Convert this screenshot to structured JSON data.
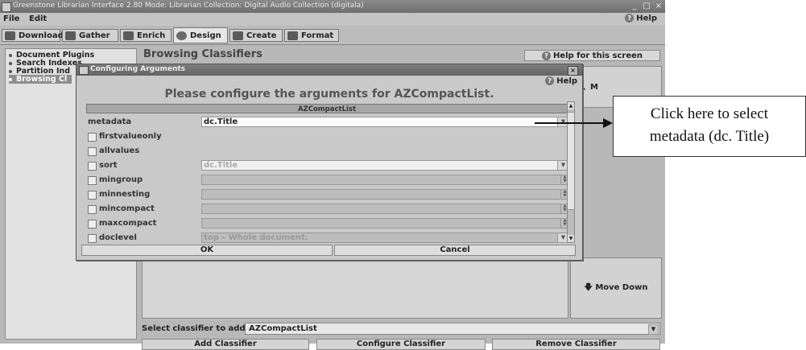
{
  "window": {
    "title": "Greenstone Librarian Interface 2.80  Mode: Librarian  Collection: Digital Audio Collection (digitala)",
    "controls": [
      "_",
      "□",
      "×"
    ]
  },
  "menu": {
    "file": "File",
    "edit": "Edit",
    "help": "Help"
  },
  "tabs": [
    {
      "label": "Download",
      "icon": "download-icon"
    },
    {
      "label": "Gather",
      "icon": "gather-icon"
    },
    {
      "label": "Enrich",
      "icon": "enrich-icon"
    },
    {
      "label": "Design",
      "icon": "design-icon",
      "active": true
    },
    {
      "label": "Create",
      "icon": "create-icon"
    },
    {
      "label": "Format",
      "icon": "format-icon"
    }
  ],
  "sidebar": {
    "items": [
      {
        "label": "Document Plugins"
      },
      {
        "label": "Search Indexes"
      },
      {
        "label": "Partition Ind"
      },
      {
        "label": "Browsing Cl",
        "selected": true
      }
    ]
  },
  "main": {
    "title": "Browsing Classifiers",
    "help_screen": "Help for this screen",
    "move_up": "M",
    "move_down": "Move Down",
    "select_label": "Select classifier to add",
    "select_value": "AZCompactList",
    "bottom_buttons": [
      "Add Classifier",
      "Configure Classifier",
      "Remove Classifier"
    ]
  },
  "dialog": {
    "title": "Configuring Arguments",
    "close": "×",
    "help": "Help",
    "heading": "Please configure the arguments for AZCompactList.",
    "header": "AZCompactList",
    "args": [
      {
        "name": "metadata",
        "checkbox": false,
        "value": "dc.Title",
        "control": "dropdown",
        "style": "white"
      },
      {
        "name": "firstvalueonly",
        "checkbox": true,
        "value": "",
        "control": "none"
      },
      {
        "name": "allvalues",
        "checkbox": true,
        "value": "",
        "control": "none"
      },
      {
        "name": "sort",
        "checkbox": true,
        "value": "dc.Title",
        "control": "dropdown",
        "style": "light"
      },
      {
        "name": "mingroup",
        "checkbox": true,
        "value": "",
        "control": "spinner"
      },
      {
        "name": "minnesting",
        "checkbox": true,
        "value": "",
        "control": "spinner"
      },
      {
        "name": "mincompact",
        "checkbox": true,
        "value": "",
        "control": "spinner"
      },
      {
        "name": "maxcompact",
        "checkbox": true,
        "value": "",
        "control": "spinner"
      },
      {
        "name": "doclevel",
        "checkbox": true,
        "value": "top – Whole document.",
        "control": "dropdown",
        "style": "grey"
      }
    ],
    "ok": "OK",
    "cancel": "Cancel"
  },
  "annotation": {
    "line1": "Click here to select",
    "line2": "metadata (dc. Title)"
  }
}
